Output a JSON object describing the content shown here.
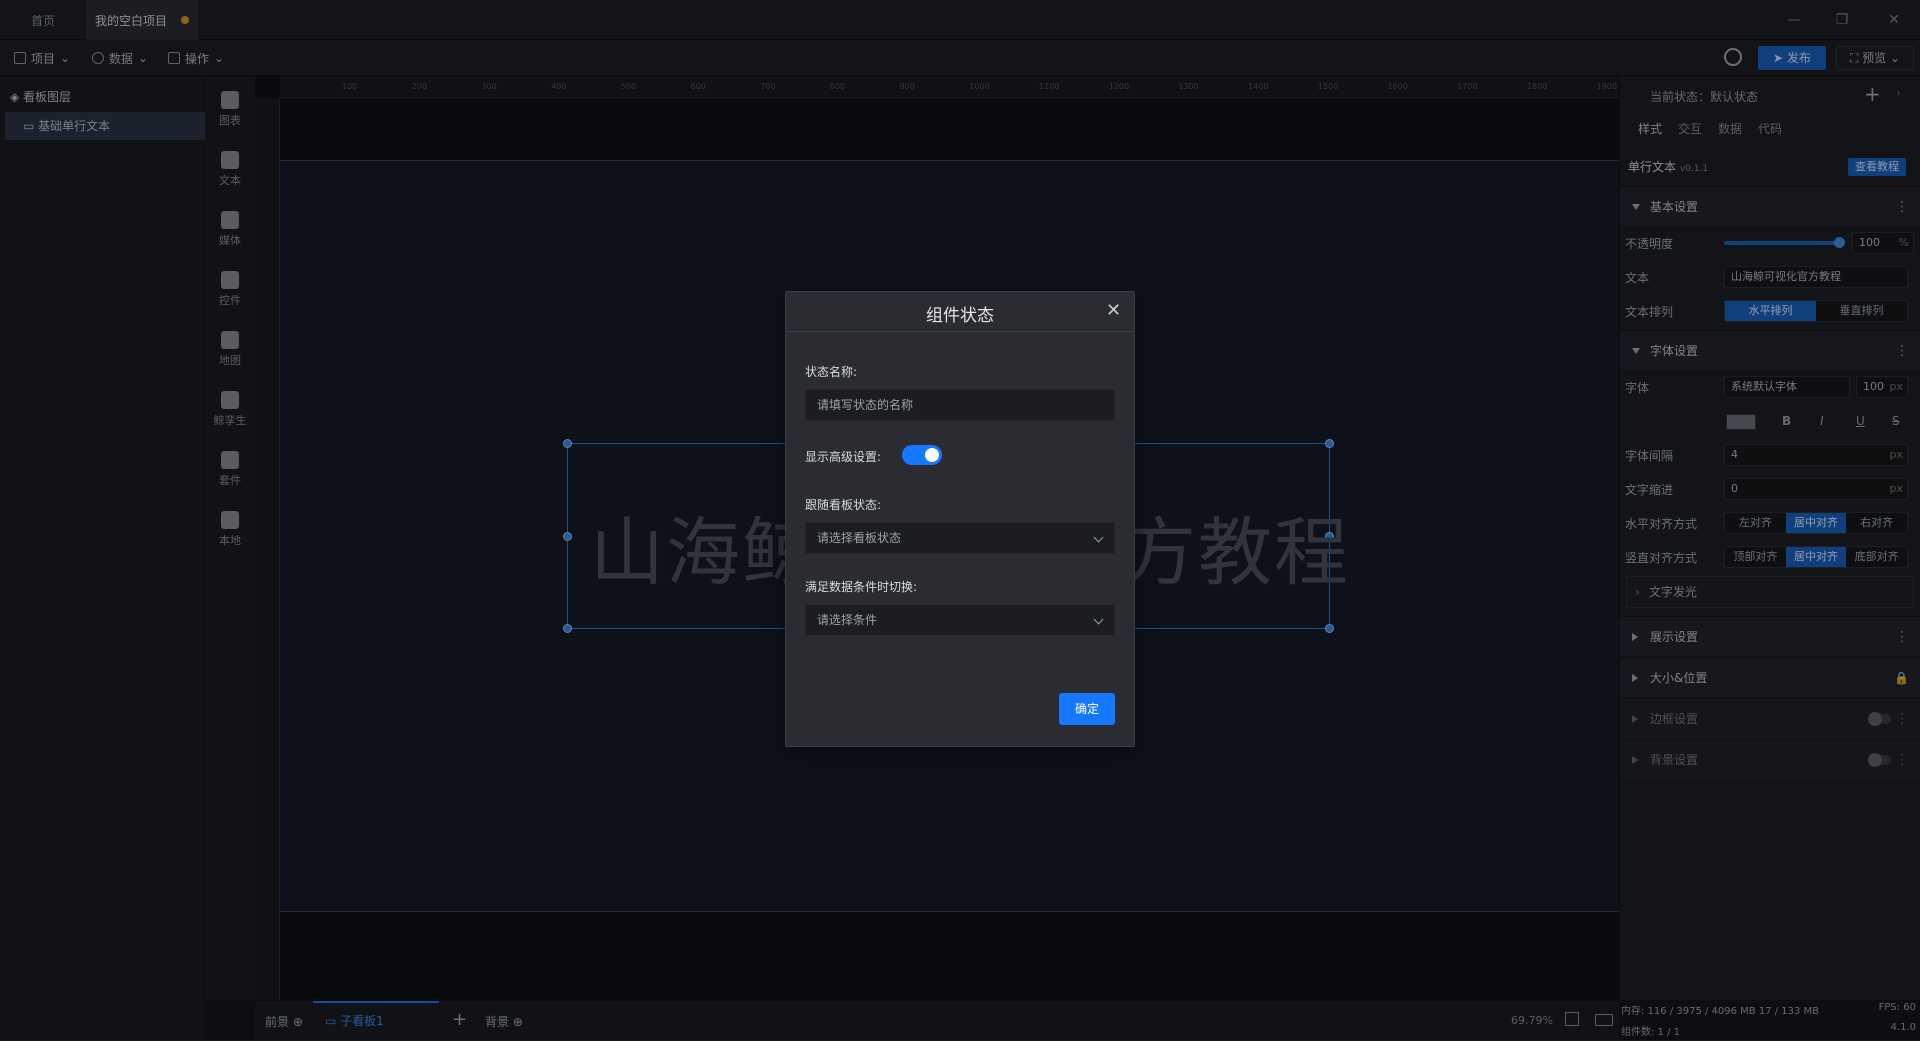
{
  "tabs": {
    "home": "首页",
    "project": "我的空白项目"
  },
  "menu": {
    "project": "项目",
    "data": "数据",
    "ops": "操作"
  },
  "topright": {
    "publish": "发布",
    "preview": "预览"
  },
  "layers": {
    "title": "看板图层",
    "item": "基础单行文本"
  },
  "tools": [
    "图表",
    "文本",
    "媒体",
    "控件",
    "地图",
    "鲸孪生",
    "套件",
    "本地"
  ],
  "ruler": [
    "100",
    "200",
    "300",
    "400",
    "500",
    "600",
    "700",
    "800",
    "900",
    "1000",
    "1100",
    "1200",
    "1300",
    "1400",
    "1500",
    "1600",
    "1700",
    "1800",
    "1900"
  ],
  "canvas": {
    "big_text": "山海鲸可视化官方教程"
  },
  "bottom": {
    "front": "前景",
    "child": "子看板1",
    "back": "背景",
    "zoom": "69.79%"
  },
  "right": {
    "state": "当前状态：默认状态",
    "tabs": [
      "样式",
      "交互",
      "数据",
      "代码"
    ],
    "component": "单行文本",
    "version": "v0.1.1",
    "tutorial": "查看教程",
    "basic": "基本设置",
    "opacity_label": "不透明度",
    "opacity_value": "100",
    "opacity_unit": "%",
    "text_label": "文本",
    "text_value": "山海鲸可视化官方教程",
    "layout_label": "文本排列",
    "layout_h": "水平排列",
    "layout_v": "垂直排列",
    "font_section": "字体设置",
    "font_label": "字体",
    "font_value": "系统默认字体",
    "font_size": "100",
    "px": "px",
    "bold": "B",
    "italic": "I",
    "underline": "U",
    "strike": "S",
    "spacing_label": "字体间隔",
    "spacing_value": "4",
    "indent_label": "文字缩进",
    "indent_value": "0",
    "halign_label": "水平对齐方式",
    "halign": [
      "左对齐",
      "居中对齐",
      "右对齐"
    ],
    "valign_label": "竖直对齐方式",
    "valign": [
      "顶部对齐",
      "居中对齐",
      "底部对齐"
    ],
    "glow": "文字发光",
    "display": "展示设置",
    "size_pos": "大小&位置",
    "border": "边框设置",
    "background": "背景设置",
    "memory": "内存:  116 / 3975 / 4096 MB  17 / 133 MB",
    "fps": "FPS:  60",
    "count": "组件数: 1 / 1",
    "ver": "4.1.0"
  },
  "modal": {
    "title": "组件状态",
    "name_label": "状态名称:",
    "name_placeholder": "请填写状态的名称",
    "advanced_label": "显示高级设置:",
    "advanced_on": true,
    "follow_label": "跟随看板状态:",
    "follow_placeholder": "请选择看板状态",
    "cond_label": "满足数据条件时切换:",
    "cond_placeholder": "请选择条件",
    "ok": "确定"
  },
  "colors": {
    "accent": "#1677ff",
    "selection": "#2e7fd6",
    "dirty_dot": "#d89b2a"
  }
}
